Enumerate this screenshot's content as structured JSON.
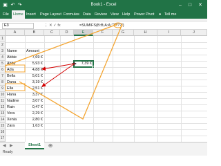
{
  "window": {
    "title": "Book1 - Excel",
    "save_icon": "save-icon",
    "undo_icon": "undo-icon",
    "redo_icon": "redo-icon"
  },
  "ribbon": {
    "tabs": [
      {
        "label": "File"
      },
      {
        "label": "Home"
      },
      {
        "label": "Insert"
      },
      {
        "label": "Page Layout"
      },
      {
        "label": "Formulas"
      },
      {
        "label": "Data"
      },
      {
        "label": "Review"
      },
      {
        "label": "View"
      },
      {
        "label": "Help"
      },
      {
        "label": "Power Pivot"
      }
    ],
    "tell_me": "Tell me",
    "active_tab": "Home"
  },
  "formula_bar": {
    "name_box": "E3",
    "fx_label": "fx",
    "formula": "=SUMIFS(B:B;A:A;\"????\")"
  },
  "grid": {
    "columns": [
      "A",
      "B",
      "C",
      "D",
      "E",
      "F",
      "G",
      "H",
      "I",
      "J"
    ],
    "rows": [
      "1",
      "2",
      "3",
      "4",
      "5",
      "6",
      "7",
      "8",
      "9",
      "10",
      "11",
      "12",
      "13",
      "14",
      "15",
      "16",
      "17"
    ],
    "headers": {
      "name": "Name",
      "amount": "Amount"
    },
    "data": [
      {
        "name": "Abbie",
        "amount": "7,69 €"
      },
      {
        "name": "Abby",
        "amount": "5,93 €"
      },
      {
        "name": "Ada",
        "amount": "4,88 €"
      },
      {
        "name": "Bella",
        "amount": "5,01 €"
      },
      {
        "name": "Dana",
        "amount": "3,19 €"
      },
      {
        "name": "Ella",
        "amount": "2,51 €"
      },
      {
        "name": "Hana",
        "amount": "3,37 €"
      },
      {
        "name": "Nadine",
        "amount": "3,07 €"
      },
      {
        "name": "Rain",
        "amount": "0,47 €"
      },
      {
        "name": "Vera",
        "amount": "2,29 €"
      },
      {
        "name": "Xenia",
        "amount": "2,80 €"
      },
      {
        "name": "Zara",
        "amount": "1,63 €"
      }
    ],
    "result": "7,39 €",
    "cursor_icon": "cursor-icon"
  },
  "sheets": {
    "tabs": [
      {
        "label": "Sheet1"
      }
    ],
    "add_icon": "plus-icon"
  },
  "status": {
    "ready": "Ready"
  },
  "colors": {
    "excel_green": "#217346",
    "highlight_orange": "#f4a531",
    "arrow_red": "#d40000"
  }
}
